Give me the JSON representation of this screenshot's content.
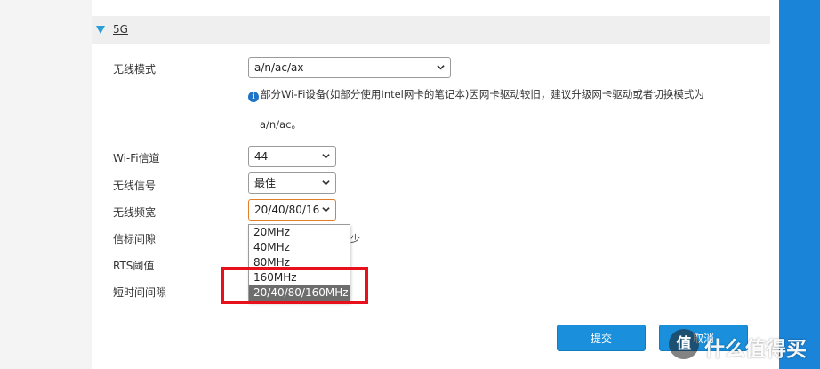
{
  "section": {
    "title": "5G"
  },
  "fields": {
    "wireless_mode": {
      "label": "无线模式",
      "value": "a/n/ac/ax"
    },
    "info": {
      "icon": "info-icon",
      "line1": "部分Wi-Fi设备(如部分使用Intel网卡的笔记本)因网卡驱动较旧，建议升级网卡驱动或者切换模式为",
      "line2": "a/n/ac。"
    },
    "channel": {
      "label": "Wi-Fi信道",
      "value": "44"
    },
    "signal": {
      "label": "无线信号",
      "value": "最佳"
    },
    "bandwidth": {
      "label": "无线频宽",
      "value": "20/40/80/16",
      "options": [
        "20MHz",
        "40MHz",
        "80MHz",
        "160MHz",
        "20/40/80/160MHz"
      ],
      "selected_index": 4
    },
    "beacon": {
      "label": "信标间隙",
      "unit_partial": "少"
    },
    "rts": {
      "label": "RTS阈值"
    },
    "short_gi": {
      "label": "短时间间隙"
    }
  },
  "buttons": {
    "submit": "提交",
    "cancel": "取消"
  },
  "watermark": {
    "icon_text": "值",
    "text": "什么值得买"
  },
  "colors": {
    "accent_blue": "#1a84d8",
    "button_blue": "#1a8fdb",
    "highlight_red": "#e8101a",
    "select_focus": "#e37f2b",
    "selected_option": "#6d6d6d"
  }
}
